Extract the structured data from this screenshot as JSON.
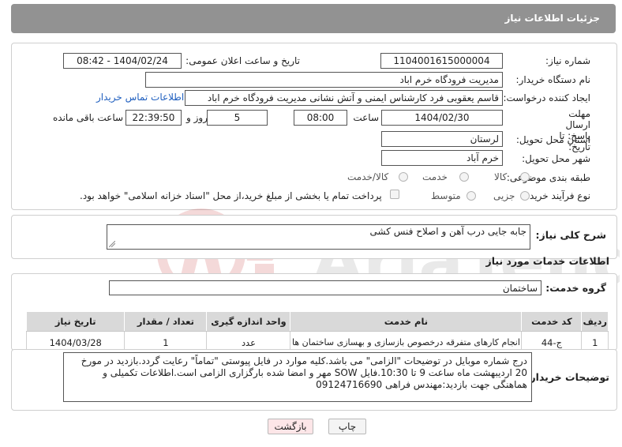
{
  "header": {
    "title": "جزئیات اطلاعات نیاز"
  },
  "form": {
    "need_number_label": "شماره نیاز:",
    "need_number": "1104001615000004",
    "announce_label": "تاریخ و ساعت اعلان عمومی:",
    "announce_value": "1404/02/24 - 08:42",
    "buyer_org_label": "نام دستگاه خریدار:",
    "buyer_org": "مدیریت فرودگاه خرم اباد",
    "creator_label": "ایجاد کننده درخواست:",
    "creator": "قاسم یعقوبی فرد کارشناس ایمنی و آتش نشانی مدیریت فرودگاه خرم اباد",
    "contact_link": "اطلاعات تماس خریدار",
    "deadline_label": "مهلت ارسال پاسخ: تا تاریخ:",
    "deadline_date": "1404/02/30",
    "time_label": "ساعت",
    "deadline_time": "08:00",
    "days_value": "5",
    "days_label": "روز و",
    "remaining_time": "22:39:50",
    "remaining_label": "ساعت باقی مانده",
    "province_label": "استان محل تحویل:",
    "province": "لرستان",
    "city_label": "شهر محل تحویل:",
    "city": "خرم آباد",
    "category_label": "طبقه بندی موضوعی:",
    "category_options": [
      "کالا",
      "خدمت",
      "کالا/خدمت"
    ],
    "process_label": "نوع فرآیند خرید :",
    "process_options": [
      "جزیی",
      "متوسط"
    ],
    "payment_text": "پرداخت تمام یا بخشی از مبلغ خرید،از محل \"اسناد خزانه اسلامی\" خواهد بود."
  },
  "general": {
    "label": "شرح کلی نیاز:",
    "value": "جابه جایی درب آهن و اصلاح فنس کشی"
  },
  "services": {
    "section_title": "اطلاعات خدمات مورد نیاز",
    "group_label": "گروه خدمت:",
    "group_value": "ساختمان",
    "columns": [
      "ردیف",
      "کد خدمت",
      "نام خدمت",
      "واحد اندازه گیری",
      "تعداد / مقدار",
      "تاریخ نیاز"
    ],
    "rows": [
      [
        "1",
        "ج-44",
        "انجام کارهای متفرقه درخصوص بازسازی و بهسازی ساختمان ها",
        "عدد",
        "1",
        "1404/03/28"
      ]
    ]
  },
  "buyer_notes": {
    "label": "توضیحات خریدار:",
    "text": "درج شماره موبایل در توضیحات \"الزامی\" می باشد.کلیه موارد در فایل پیوستی \"تماماً\" رعایت گردد.بازدید در مورخ 20 اردیبهشت ماه ساعت 9 تا 10:30.فایل SOW مهر و امضا شده بارگزاری الزامی است.اطلاعات تکمیلی و هماهنگی جهت بازدید:مهندس فراهی 09124716690"
  },
  "buttons": {
    "print": "چاپ",
    "back": "بازگشت"
  },
  "colors": {
    "header": "#929292",
    "link": "#1f5fbf",
    "back_bg": "#fde6e8",
    "watermark": "#c01818"
  }
}
